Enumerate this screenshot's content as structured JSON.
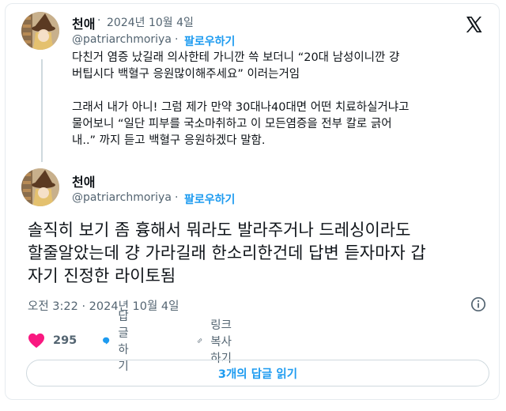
{
  "tweet1": {
    "author_name": "천애",
    "date": "2024년 10월 4일",
    "handle": "@patriarchmoriya",
    "follow_label": "팔로우하기",
    "dot": "·",
    "separator": "·",
    "body": "다친거 염증 났길래 의사한테 가니깐 쓱 보더니 “20대 남성이니깐 걍\n버팁시다 백혈구 응원많이해주세요” 이러는거임\n\n그래서 내가 아니! 그럼 제가 만약 30대나40대면 어떤 치료하실거냐고\n물어보니 “일단 피부를 국소마취하고 이 모든염증을 전부 칼로 긁어\n내..” 까지 듣고 백혈구 응원하겠다 말함."
  },
  "tweet2": {
    "author_name": "천애",
    "handle": "@patriarchmoriya",
    "follow_label": "팔로우하기",
    "dot": "·",
    "body": "솔직히 보기 좀 흉해서 뭐라도 발라주거나 드레싱이라도\n할줄알았는데 걍 가라길래 한소리한건데 답변 듣자마자 갑\n자기 진정한 라이토됨",
    "timestamp": "오전 3:22 · 2024년 10월 4일"
  },
  "actions": {
    "like_count": "295",
    "reply_label": "답글하기",
    "copy_link_label": "링크 복사하기"
  },
  "replies_button_label": "3개의 답글 읽기",
  "colors": {
    "accent": "#1d9bf0",
    "like": "#f91880",
    "text": "#0f1419",
    "muted": "#536471"
  },
  "icons": [
    "x-logo-icon",
    "like-heart-icon",
    "reply-bubble-icon",
    "link-icon",
    "info-icon"
  ]
}
